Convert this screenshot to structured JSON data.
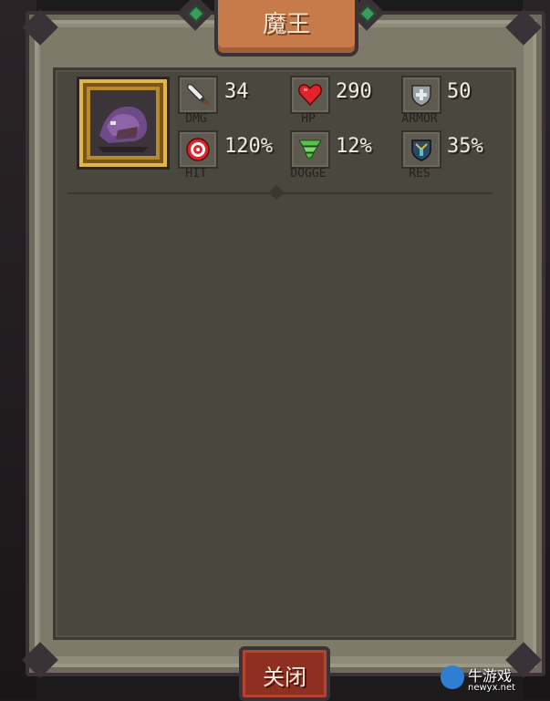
{
  "title": "魔王",
  "close_button": "关闭",
  "stats": {
    "dmg": {
      "label": "DMG",
      "value": "34",
      "icon": "sword-icon"
    },
    "hp": {
      "label": "HP",
      "value": "290",
      "icon": "heart-icon"
    },
    "armor": {
      "label": "ARMOR",
      "value": "50",
      "icon": "shield-icon"
    },
    "hit": {
      "label": "HIT",
      "value": "120%",
      "icon": "target-icon"
    },
    "dodge": {
      "label": "DOGGE",
      "value": "12%",
      "icon": "tornado-icon"
    },
    "res": {
      "label": "RES",
      "value": "35%",
      "icon": "resist-shield-icon"
    }
  },
  "watermark": {
    "text": "牛游戏",
    "sub": "newyx.net"
  },
  "colors": {
    "title_tab": "#c77a4a",
    "close_button": "#8e2f22",
    "panel": "#4a473e"
  }
}
